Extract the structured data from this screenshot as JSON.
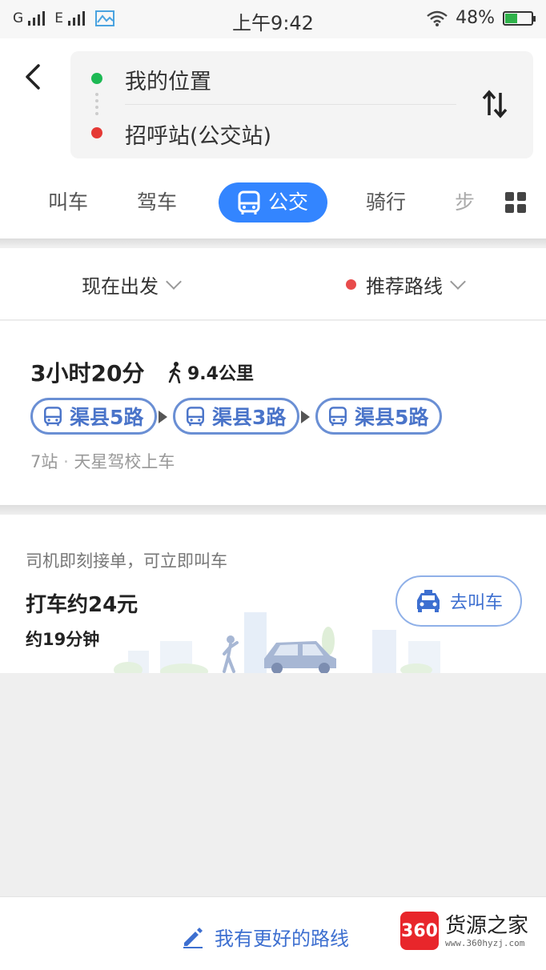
{
  "status_bar": {
    "carrier1": "G",
    "carrier2": "E",
    "time": "上午9:42",
    "battery": "48%",
    "battery_level": 0.48
  },
  "route": {
    "origin": "我的位置",
    "destination": "招呼站(公交站)",
    "origin_color": "#1db954",
    "destination_color": "#e53935"
  },
  "tabs": [
    {
      "label": "叫车"
    },
    {
      "label": "驾车"
    },
    {
      "label": "公交",
      "active": true
    },
    {
      "label": "骑行"
    },
    {
      "label": "步"
    }
  ],
  "filters": {
    "depart": "现在出发",
    "preference": "推荐路线",
    "preference_dot_color": "#e84b4b"
  },
  "result": {
    "duration": "3小时20分",
    "walk_distance": "9.4公里",
    "lines": [
      "渠县5路",
      "渠县3路",
      "渠县5路"
    ],
    "stops_count": "7站",
    "boarding": "天星驾校上车"
  },
  "taxi": {
    "hint": "司机即刻接单，可立即叫车",
    "price": "打车约24元",
    "time": "约19分钟",
    "button": "去叫车"
  },
  "footer": {
    "better_route": "我有更好的路线"
  },
  "watermark": {
    "logo": "360",
    "title": "货源之家",
    "url": "www.360hyzj.com"
  },
  "colors": {
    "accent": "#3385ff",
    "chip": "#4a74c9"
  }
}
